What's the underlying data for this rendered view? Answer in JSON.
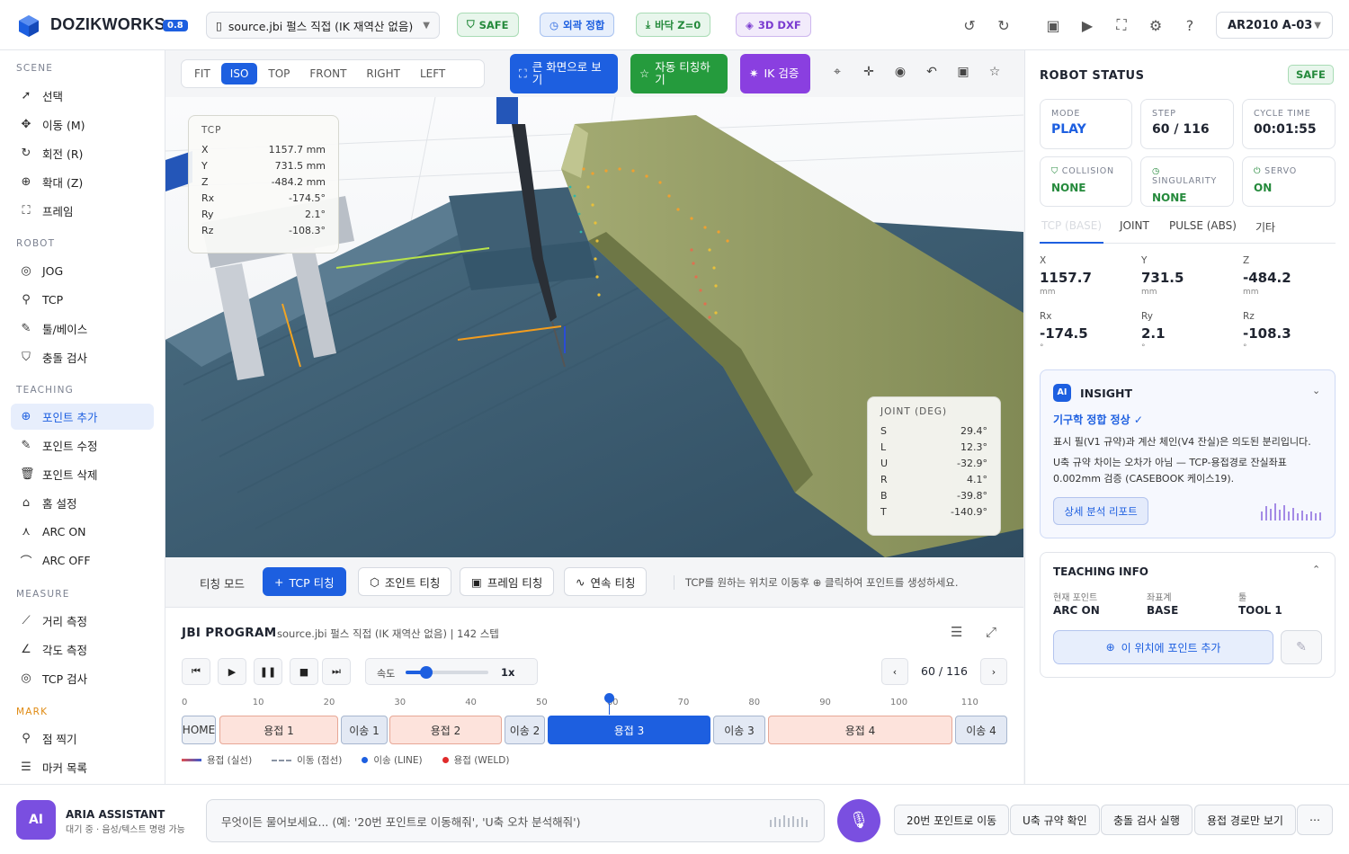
{
  "app": {
    "brand": "DOZIKWORKS",
    "version": "0.8"
  },
  "file": {
    "name": "source.jbi 펄스 직접 (IK 재역산 없음)"
  },
  "top_tags": {
    "safe": "SAFE",
    "verify": "외곽 정합",
    "floor": "바닥 Z=0",
    "dxf": "3D DXF"
  },
  "robot_select": "AR2010 A-03",
  "sidebar": {
    "scene": {
      "title": "SCENE",
      "items": [
        "선택",
        "이동 (M)",
        "회전 (R)",
        "확대 (Z)",
        "프레임"
      ]
    },
    "robot": {
      "title": "ROBOT",
      "items": [
        "JOG",
        "TCP",
        "툴/베이스",
        "충돌 검사"
      ]
    },
    "teaching": {
      "title": "TEACHING",
      "items": [
        "포인트 추가",
        "포인트 수정",
        "포인트 삭제",
        "홈 설정",
        "ARC ON",
        "ARC OFF"
      ]
    },
    "measure": {
      "title": "MEASURE",
      "items": [
        "거리 측정",
        "각도 측정",
        "TCP 검사"
      ]
    },
    "mark": {
      "title": "MARK",
      "items": [
        "점 찍기",
        "마커 목록"
      ]
    }
  },
  "views": [
    "FIT",
    "ISO",
    "TOP",
    "FRONT",
    "RIGHT",
    "LEFT"
  ],
  "active_view": "ISO",
  "viewport_actions": {
    "fullscreen": "큰 화면으로 보기",
    "auto_teach": "자동 티칭하기",
    "ik_check": "IK 검증"
  },
  "tcp_overlay": {
    "title": "TCP",
    "rows": [
      [
        "X",
        "1157.7 mm"
      ],
      [
        "Y",
        "731.5 mm"
      ],
      [
        "Z",
        "-484.2 mm"
      ],
      [
        "Rx",
        "-174.5°"
      ],
      [
        "Ry",
        "2.1°"
      ],
      [
        "Rz",
        "-108.3°"
      ]
    ]
  },
  "joint_overlay": {
    "title": "JOINT (DEG)",
    "rows": [
      [
        "S",
        "29.4°"
      ],
      [
        "L",
        "12.3°"
      ],
      [
        "U",
        "-32.9°"
      ],
      [
        "R",
        "4.1°"
      ],
      [
        "B",
        "-39.8°"
      ],
      [
        "T",
        "-140.9°"
      ]
    ]
  },
  "teach_bar": {
    "label": "티칭 모드",
    "tcp": "TCP 티칭",
    "joint": "조인트 티칭",
    "frame": "프레임 티칭",
    "cont": "연속 티칭",
    "hint": "TCP를 원하는 위치로 이동후 ⊕ 클릭하여 포인트를 생성하세요."
  },
  "program": {
    "title": "JBI PROGRAM",
    "subtitle": "source.jbi 펄스 직접 (IK 재역산 없음) | 142 스텝",
    "speed_label": "속도",
    "speed_value": "1x",
    "speed_fraction": 0.25,
    "page": "60 / 116",
    "ticks": [
      "0",
      "10",
      "20",
      "30",
      "40",
      "50",
      "60",
      "70",
      "80",
      "90",
      "100",
      "110"
    ],
    "segments": [
      {
        "label": "HOME",
        "type": "home"
      },
      {
        "label": "용접 1",
        "type": "weld"
      },
      {
        "label": "이송 1",
        "type": "move"
      },
      {
        "label": "용접 2",
        "type": "weld"
      },
      {
        "label": "이송 2",
        "type": "move"
      },
      {
        "label": "용접 3",
        "type": "cur"
      },
      {
        "label": "이송 3",
        "type": "move"
      },
      {
        "label": "용접 4",
        "type": "weld"
      },
      {
        "label": "이송 4",
        "type": "move"
      }
    ],
    "legend": [
      "용접 (실선)",
      "이동 (점선)",
      "이송 (LINE)",
      "용접 (WELD)"
    ]
  },
  "status": {
    "title": "ROBOT STATUS",
    "badge": "SAFE",
    "mode": {
      "label": "MODE",
      "value": "PLAY"
    },
    "step": {
      "label": "STEP",
      "value": "60 / 116"
    },
    "cycle": {
      "label": "CYCLE TIME",
      "value": "00:01:55"
    },
    "collision": {
      "label": "COLLISION",
      "value": "NONE"
    },
    "singularity": {
      "label": "SINGULARITY",
      "value": "NONE"
    },
    "servo": {
      "label": "SERVO",
      "value": "ON"
    },
    "tabs": [
      "TCP (BASE)",
      "JOINT",
      "PULSE (ABS)",
      "기타"
    ],
    "coords": [
      {
        "k": "X",
        "v": "1157.7",
        "u": "mm"
      },
      {
        "k": "Y",
        "v": "731.5",
        "u": "mm"
      },
      {
        "k": "Z",
        "v": "-484.2",
        "u": "mm"
      },
      {
        "k": "Rx",
        "v": "-174.5",
        "u": "°"
      },
      {
        "k": "Ry",
        "v": "2.1",
        "u": "°"
      },
      {
        "k": "Rz",
        "v": "-108.3",
        "u": "°"
      }
    ]
  },
  "insight": {
    "badge": "AI",
    "title": "INSIGHT",
    "headline": "기구학 정합 정상 ✓",
    "p1": "표시 필(V1 규약)과 계산 체인(V4 잔실)은 의도된 분리입니다.",
    "p2": "U축 규약 차이는 오차가 아님 — TCP-용접경로 잔실좌표 0.002mm 검증 (CASEBOOK 케이스19).",
    "button": "상세 분석 리포트"
  },
  "teaching_info": {
    "title": "TEACHING INFO",
    "point_label": "현재 포인트",
    "point": "ARC ON",
    "frame_label": "좌표계",
    "frame": "BASE",
    "tool_label": "툴",
    "tool": "TOOL 1",
    "add": "이 위치에 포인트 추가"
  },
  "assistant": {
    "badge": "AI",
    "name": "ARIA ASSISTANT",
    "status": "대기 중 · 음성/텍스트 명령 가능",
    "placeholder": "무엇이든 물어보세요... (예: '20번 포인트로 이동해줘', 'U축 오차 분석해줘')",
    "quick": [
      "20번 포인트로 이동",
      "U축 규약 확인",
      "충돌 검사 실행",
      "용접 경로만 보기"
    ]
  },
  "colors": {
    "accent": "#1d5fe0",
    "safe": "#258a3c",
    "purple": "#7a3bd0",
    "weld": "#fde3dc"
  }
}
